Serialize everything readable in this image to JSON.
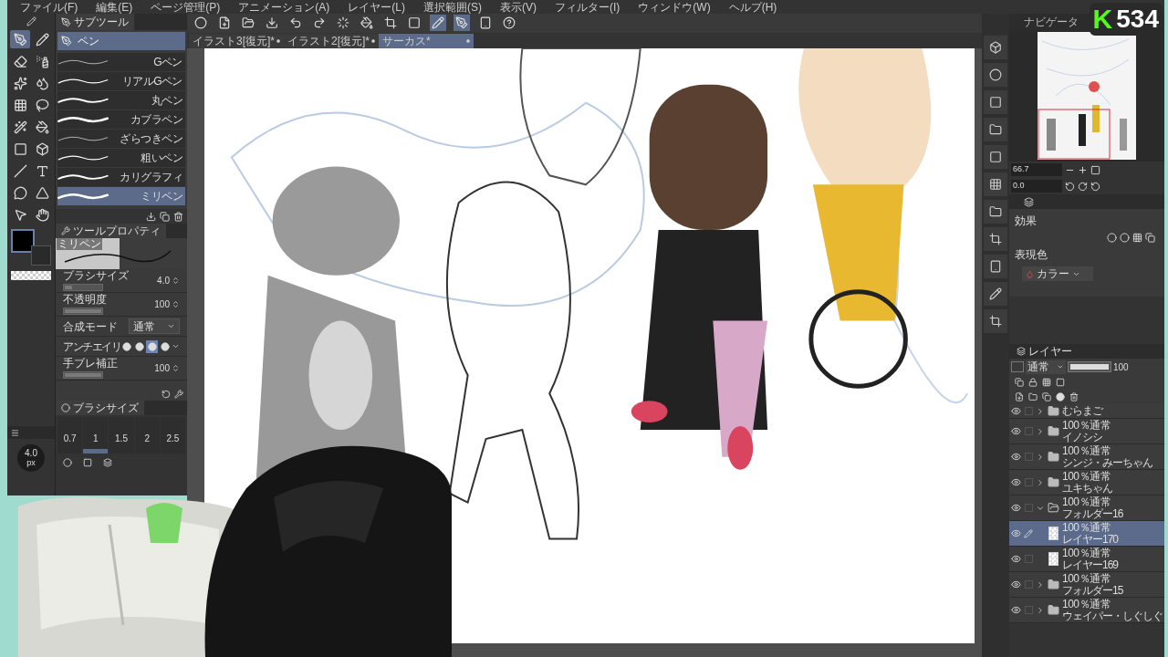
{
  "menu": [
    "ファイル(F)",
    "編集(E)",
    "ページ管理(P)",
    "アニメーション(A)",
    "レイヤー(L)",
    "選択範囲(S)",
    "表示(V)",
    "フィルター(I)",
    "ウィンドウ(W)",
    "ヘルプ(H)"
  ],
  "document_tabs": [
    {
      "label": "イラスト3[復元]*",
      "selected": false
    },
    {
      "label": "イラスト2[復元]*",
      "selected": false
    },
    {
      "label": "サーカス*",
      "selected": true
    }
  ],
  "tools": [
    {
      "selected": true
    },
    {
      "selected": false
    },
    {
      "selected": false
    },
    {
      "selected": false
    },
    {
      "selected": false
    },
    {
      "selected": false
    },
    {
      "selected": false
    },
    {
      "selected": false
    },
    {
      "selected": false
    },
    {
      "selected": false
    },
    {
      "selected": false
    },
    {
      "selected": false
    },
    {
      "selected": false
    },
    {
      "selected": false
    },
    {
      "selected": false
    },
    {
      "selected": false
    },
    {
      "selected": false
    },
    {
      "selected": false
    }
  ],
  "subtool_panel": {
    "title": "サブツール",
    "group": "ペン",
    "items": [
      {
        "label": "Gペン",
        "selected": false
      },
      {
        "label": "リアルGペン",
        "selected": false
      },
      {
        "label": "丸ペン",
        "selected": false
      },
      {
        "label": "カブラペン",
        "selected": false
      },
      {
        "label": "ざらつきペン",
        "selected": false
      },
      {
        "label": "粗いペン",
        "selected": false
      },
      {
        "label": "カリグラフィ",
        "selected": false
      },
      {
        "label": "ミリペン",
        "selected": true
      }
    ]
  },
  "tool_property": {
    "title": "ツールプロパティ",
    "preview_label": "ミリペン",
    "rows": [
      {
        "kind": "slider",
        "label": "ブラシサイズ",
        "value": "4.0",
        "level": 0.2
      },
      {
        "kind": "slider",
        "label": "不透明度",
        "value": "100",
        "level": 1
      },
      {
        "kind": "dropdown",
        "label": "合成モード",
        "value": "通常"
      },
      {
        "kind": "antialias",
        "label": "アンチエイリ",
        "options": [
          {
            "selected": false
          },
          {
            "selected": false
          },
          {
            "selected": true
          },
          {
            "selected": false
          }
        ]
      },
      {
        "kind": "slider",
        "label": "手ブレ補正",
        "value": "100",
        "level": 1
      }
    ]
  },
  "brush_size_readout": {
    "value": "4.0",
    "unit": "px"
  },
  "brush_size_panel": {
    "title": "ブラシサイズ",
    "sizes": [
      {
        "label": "0.7",
        "selected": false
      },
      {
        "label": "1",
        "selected": true
      },
      {
        "label": "1.5",
        "selected": false
      },
      {
        "label": "2",
        "selected": false
      },
      {
        "label": "2.5",
        "selected": false
      }
    ]
  },
  "navigator": {
    "title": "ナビゲータ",
    "zoom": "66.7",
    "rotation": "0.0"
  },
  "layer_property": {
    "effect_label": "効果",
    "color_label": "表現色",
    "color_mode": "カラー"
  },
  "layers": {
    "tab": "レイヤー",
    "blend": "通常",
    "opacity": "100",
    "opacity_slider": {
      "level": 1
    },
    "rows": [
      {
        "kind": "folder",
        "name": "むらまご",
        "expanded": false,
        "selected": false
      },
      {
        "kind": "folder",
        "info": "100％通常",
        "name": "イノシシ",
        "expanded": false,
        "selected": false
      },
      {
        "kind": "folder",
        "info": "100％通常",
        "name": "シンジ・みーちゃん",
        "expanded": false,
        "selected": false
      },
      {
        "kind": "folder",
        "info": "100％通常",
        "name": "ユキちゃん",
        "expanded": false,
        "selected": false
      },
      {
        "kind": "folder",
        "info": "100％通常",
        "name": "フォルダー16",
        "expanded": true,
        "selected": false,
        "children": [
          {
            "kind": "layer",
            "info": "100％通常",
            "name": "レイヤー170",
            "selected": true
          },
          {
            "kind": "layer",
            "info": "100％通常",
            "name": "レイヤー169",
            "selected": false
          }
        ]
      },
      {
        "kind": "folder",
        "info": "100％通常",
        "name": "フォルダー15",
        "expanded": false,
        "selected": false
      },
      {
        "kind": "folder",
        "info": "100％通常",
        "name": "ウェイパー・しぐしぐ",
        "expanded": false,
        "selected": false
      }
    ]
  },
  "stream_overlay": {
    "logo": "K",
    "count": "534"
  }
}
